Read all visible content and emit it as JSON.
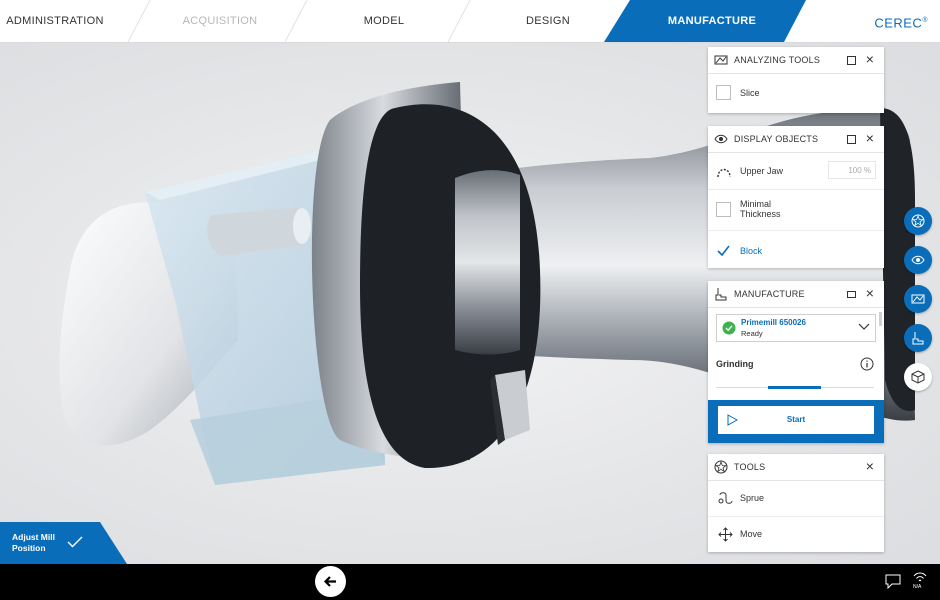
{
  "workflow": {
    "steps": [
      {
        "label": "ADMINISTRATION",
        "state": "normal"
      },
      {
        "label": "ACQUISITION",
        "state": "disabled"
      },
      {
        "label": "MODEL",
        "state": "normal"
      },
      {
        "label": "DESIGN",
        "state": "normal"
      },
      {
        "label": "MANUFACTURE",
        "state": "active"
      }
    ],
    "brand": "CEREC",
    "brand_mark": "®",
    "accent_color": "#0a6dba"
  },
  "analyzing_tools": {
    "title": "ANALYZING TOOLS",
    "icon": "analyze-icon",
    "items": [
      {
        "label": "Slice",
        "checked": false
      }
    ]
  },
  "display_objects": {
    "title": "DISPLAY OBJECTS",
    "icon": "eye-icon",
    "items": [
      {
        "label": "Upper Jaw",
        "icon": "jaw-icon",
        "value": "100 %"
      },
      {
        "label": "Minimal\nThickness",
        "checked": false
      },
      {
        "label": "Block",
        "checked": true
      }
    ]
  },
  "manufacture": {
    "title": "MANUFACTURE",
    "icon": "mill-icon",
    "device": {
      "name": "Primemill 650026",
      "status": "Ready",
      "status_color": "#3cb44b"
    },
    "mode_label": "Grinding",
    "start_label": "Start"
  },
  "tools": {
    "title": "TOOLS",
    "icon": "tools-icon",
    "items": [
      {
        "label": "Sprue",
        "icon": "sprue-icon"
      },
      {
        "label": "Move",
        "icon": "move-icon"
      }
    ]
  },
  "adjust_mill": {
    "label_line1": "Adjust Mill",
    "label_line2": "Position"
  },
  "bottom": {
    "lang_label": "N/A"
  }
}
